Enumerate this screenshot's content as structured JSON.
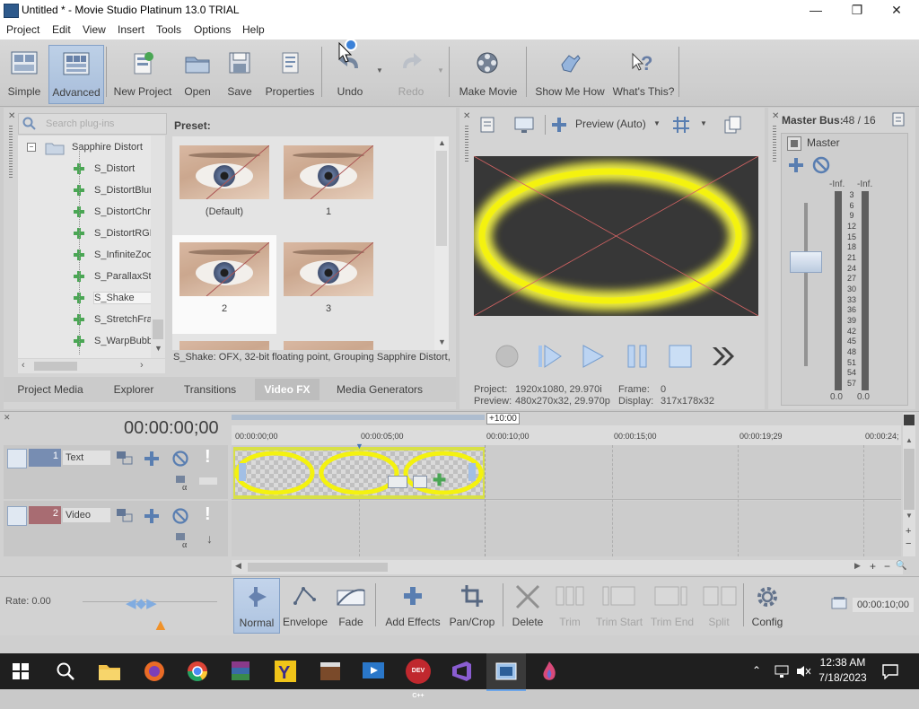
{
  "window": {
    "title": "Untitled * - Movie Studio Platinum 13.0 TRIAL",
    "minimize": "—",
    "maximize": "❐",
    "close": "✕"
  },
  "menu": [
    "Project",
    "Edit",
    "View",
    "Insert",
    "Tools",
    "Options",
    "Help"
  ],
  "toolbar": {
    "simple": "Simple",
    "advanced": "Advanced",
    "new_project": "New Project",
    "open": "Open",
    "save": "Save",
    "properties": "Properties",
    "undo": "Undo",
    "redo": "Redo",
    "make_movie": "Make Movie",
    "show_me_how": "Show Me How",
    "whats_this": "What's This?"
  },
  "plugins": {
    "search_placeholder": "Search plug-ins",
    "group": "Sapphire Distort",
    "items": [
      "S_Distort",
      "S_DistortBlur",
      "S_DistortChroma",
      "S_DistortRGB",
      "S_InfiniteZoom",
      "S_ParallaxStrips",
      "S_Shake",
      "S_StretchFrameEdges",
      "S_WarpBubble"
    ],
    "selected": "S_Shake"
  },
  "presets": {
    "header": "Preset:",
    "items": [
      "(Default)",
      "1",
      "2",
      "3"
    ],
    "selected": "2",
    "status": "S_Shake: OFX, 32-bit floating point, Grouping  Sapphire Distort,"
  },
  "dock_tabs": [
    "Project Media",
    "Explorer",
    "Transitions",
    "Video FX",
    "Media Generators"
  ],
  "dock_active": "Video FX",
  "preview": {
    "mode": "Preview (Auto)",
    "project_label": "Project:",
    "project_value": "1920x1080, 29.970i",
    "preview_label": "Preview:",
    "preview_value": "480x270x32, 29.970p",
    "frame_label": "Frame:",
    "frame_value": "0",
    "display_label": "Display:",
    "display_value": "317x178x32"
  },
  "master": {
    "title": "Master Bus:",
    "ratio": "48 / 16",
    "label": "Master",
    "peak_left": "-Inf.",
    "peak_right": "-Inf.",
    "scale": [
      "3",
      "6",
      "9",
      "12",
      "15",
      "18",
      "21",
      "24",
      "27",
      "30",
      "33",
      "36",
      "39",
      "42",
      "45",
      "48",
      "51",
      "54",
      "57"
    ],
    "bottom_left": "0.0",
    "bottom_right": "0.0"
  },
  "timeline": {
    "timecode": "00:00:00;00",
    "marker": "+10:00",
    "ruler": [
      "00:00:00;00",
      "00:00:05;00",
      "00:00:10;00",
      "00:00:15;00",
      "00:00:19;29",
      "00:00:24;"
    ],
    "tracks": [
      {
        "number": "1",
        "name": "Text"
      },
      {
        "number": "2",
        "name": "Video"
      }
    ],
    "rate": "Rate: 0.00",
    "end_time": "00:00:10;00"
  },
  "bottom_tools": {
    "normal": "Normal",
    "envelope": "Envelope",
    "fade": "Fade",
    "add_effects": "Add Effects",
    "pan_crop": "Pan/Crop",
    "delete": "Delete",
    "trim": "Trim",
    "trim_start": "Trim Start",
    "trim_end": "Trim End",
    "split": "Split",
    "config": "Config"
  },
  "taskbar": {
    "time": "12:38 AM",
    "date": "7/18/2023",
    "dev_label": "DEV C++"
  },
  "colors": {
    "accent": "#2f7ad6",
    "clip": "#d8e03a",
    "glow": "#f2f200"
  }
}
